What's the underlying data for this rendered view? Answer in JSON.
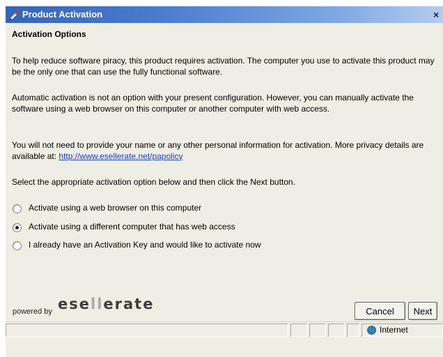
{
  "window": {
    "title": "Product Activation",
    "close_glyph": "×"
  },
  "content": {
    "heading": "Activation Options",
    "paragraph1": "To help reduce software piracy, this product requires activation. The computer you use to activate this product may be the only one that can use the fully functional software.",
    "paragraph2": "Automatic activation is not an option with your present configuration. However, you can manually activate the software using a web browser on this computer or another computer with web access.",
    "paragraph3_text": "You will not need to provide your name or any other personal information for activation. More privacy details are available at: ",
    "privacy_link": "http://www.esellerate.net/papolicy",
    "instruction": "Select the appropriate activation option below and then click the Next button.",
    "options": [
      {
        "label": "Activate using a web browser on this computer",
        "selected": false
      },
      {
        "label": "Activate using a different computer that has web access",
        "selected": true
      },
      {
        "label": "I already have an Activation Key and would like to activate now",
        "selected": false
      }
    ]
  },
  "footer": {
    "powered_by": "powered by",
    "logo_part1": "ese",
    "logo_part2": "ll",
    "logo_part3": "erate",
    "cancel_label": "Cancel",
    "next_label": "Next"
  },
  "statusbar": {
    "zone_label": "Internet"
  },
  "colors": {
    "titlebar_start": "#3565b8",
    "titlebar_end": "#b4cdef",
    "link": "#1a3cc8",
    "dialog_background": "#efeee4"
  },
  "icons": {
    "title": "pen-check-icon",
    "zone": "globe-icon"
  }
}
